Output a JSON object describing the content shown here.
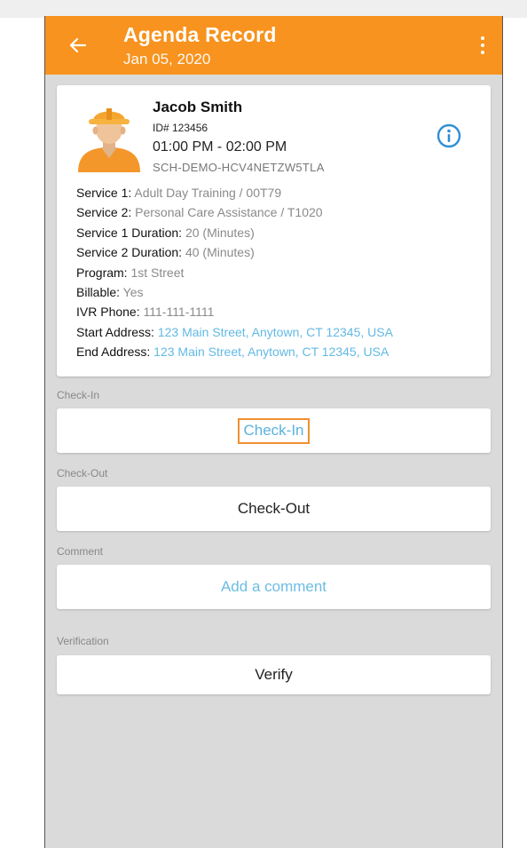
{
  "app_bar": {
    "title": "Agenda Record",
    "date": "Jan 05, 2020",
    "back_icon": "arrow-left-icon",
    "menu_icon": "more-vertical-icon"
  },
  "client": {
    "name": "Jacob Smith",
    "id": "ID# 123456",
    "time": "01:00 PM - 02:00 PM",
    "code": "SCH-DEMO-HCV4NETZW5TLA",
    "avatar_icon": "worker-avatar-icon",
    "info_icon": "info-icon"
  },
  "details": [
    {
      "label": "Service 1:",
      "value": "Adult Day Training / 00T79",
      "link": false
    },
    {
      "label": "Service 2:",
      "value": "Personal Care Assistance / T1020",
      "link": false
    },
    {
      "label": "Service 1 Duration:",
      "value": "20 (Minutes)",
      "link": false
    },
    {
      "label": "Service 2 Duration:",
      "value": "40 (Minutes)",
      "link": false
    },
    {
      "label": "Program:",
      "value": "1st Street",
      "link": false
    },
    {
      "label": "Billable:",
      "value": "Yes",
      "link": false
    },
    {
      "label": "IVR Phone:",
      "value": "111-111-1111",
      "link": false
    },
    {
      "label": "Start Address:",
      "value": "123 Main Street, Anytown, CT 12345, USA",
      "link": true
    },
    {
      "label": "End Address:",
      "value": "123 Main Street, Anytown, CT 12345, USA",
      "link": true
    }
  ],
  "sections": {
    "checkin": {
      "label": "Check-In",
      "button": "Check-In"
    },
    "checkout": {
      "label": "Check-Out",
      "button": "Check-Out"
    },
    "comment": {
      "label": "Comment",
      "placeholder": "Add a comment"
    },
    "verification": {
      "label": "Verification",
      "button": "Verify"
    }
  },
  "colors": {
    "accent": "#f7931e",
    "link": "#62b9e4",
    "background": "#dadada"
  }
}
